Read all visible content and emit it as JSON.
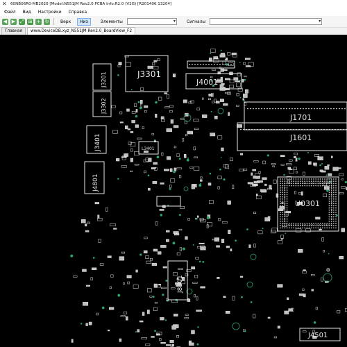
{
  "window": {
    "title": "60NB06R0-MB2020 [Model:N551JM Rev2.0 PCBA Info:R2.0 (V2G) [R201406 13204]"
  },
  "menu": [
    "Файл",
    "Вид",
    "Настройки",
    "Справка"
  ],
  "toolbar": {
    "top_label": "Верх",
    "bottom_label": "Низ",
    "active_side": "Низ",
    "elements_label": "Элементы",
    "signals_label": "Сигналы",
    "elements_value": "",
    "signals_value": ""
  },
  "tabs": [
    "Главная",
    "www.DeviceDB.xyz_N551JM Rev2.0_BoardView_F2"
  ],
  "active_tab": 1,
  "board": {
    "colors": {
      "bg": "#000000",
      "outline": "#e6e6e6",
      "pad": "#bfbfbf",
      "via": "#2ea36b"
    },
    "labels": [
      "J3301",
      "J4001",
      "J1701",
      "J1601",
      "U0301",
      "J3401",
      "J4801",
      "J3201",
      "J3302",
      "L3401",
      "J8301",
      "J4501"
    ]
  }
}
